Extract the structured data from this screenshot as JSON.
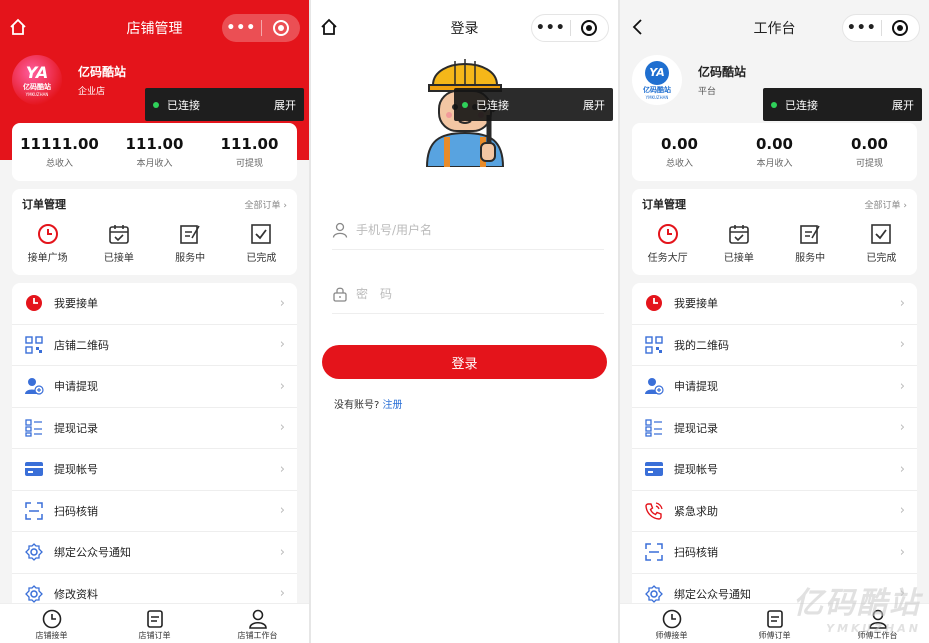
{
  "colors": {
    "accent": "#e4141b",
    "link": "#2a6fd6",
    "connected": "#2fd15a"
  },
  "common": {
    "capsule_dots": "•••",
    "connected": "已连接",
    "expand": "展开",
    "arrow": "›"
  },
  "panel1": {
    "title": "店铺管理",
    "store_name": "亿码酷站",
    "store_type": "企业店",
    "logo_text": "亿码酷站",
    "logo_sub": "YMKUZHAN",
    "stats": [
      {
        "value": "11111.00",
        "label": "总收入"
      },
      {
        "value": "111.00",
        "label": "本月收入"
      },
      {
        "value": "111.00",
        "label": "可提现"
      }
    ],
    "orders_title": "订单管理",
    "orders_all": "全部订单 ›",
    "order_items": [
      {
        "label": "接单广场",
        "icon": "clock-icon"
      },
      {
        "label": "已接单",
        "icon": "calendar-check-icon"
      },
      {
        "label": "服务中",
        "icon": "edit-icon"
      },
      {
        "label": "已完成",
        "icon": "checkbox-icon"
      }
    ],
    "menu": [
      {
        "label": "我要接单",
        "icon": "clock-filled-icon"
      },
      {
        "label": "店铺二维码",
        "icon": "qrcode-icon"
      },
      {
        "label": "申请提现",
        "icon": "user-add-icon"
      },
      {
        "label": "提现记录",
        "icon": "list-icon"
      },
      {
        "label": "提现帐号",
        "icon": "card-icon"
      },
      {
        "label": "扫码核销",
        "icon": "scan-icon"
      },
      {
        "label": "绑定公众号通知",
        "icon": "gear-icon"
      },
      {
        "label": "修改资料",
        "icon": "gear-icon"
      }
    ],
    "tabs": [
      {
        "label": "店铺接单",
        "icon": "clock-icon"
      },
      {
        "label": "店铺订单",
        "icon": "order-icon"
      },
      {
        "label": "店铺工作台",
        "icon": "person-icon"
      }
    ]
  },
  "panel2": {
    "title": "登录",
    "phone_placeholder": "手机号/用户名",
    "password_placeholder": "密　码",
    "login_button": "登录",
    "no_account": "没有账号?",
    "register": "注册"
  },
  "panel3": {
    "title": "工作台",
    "store_name": "亿码酷站",
    "store_type": "平台",
    "logo_text": "亿码酷站",
    "logo_sub": "YMKUZHAN",
    "stats": [
      {
        "value": "0.00",
        "label": "总收入"
      },
      {
        "value": "0.00",
        "label": "本月收入"
      },
      {
        "value": "0.00",
        "label": "可提现"
      }
    ],
    "orders_title": "订单管理",
    "orders_all": "全部订单 ›",
    "order_items": [
      {
        "label": "任务大厅",
        "icon": "clock-icon"
      },
      {
        "label": "已接单",
        "icon": "calendar-check-icon"
      },
      {
        "label": "服务中",
        "icon": "edit-icon"
      },
      {
        "label": "已完成",
        "icon": "checkbox-icon"
      }
    ],
    "menu": [
      {
        "label": "我要接单",
        "icon": "clock-filled-icon"
      },
      {
        "label": "我的二维码",
        "icon": "qrcode-icon"
      },
      {
        "label": "申请提现",
        "icon": "user-add-icon"
      },
      {
        "label": "提现记录",
        "icon": "list-icon"
      },
      {
        "label": "提现帐号",
        "icon": "card-icon"
      },
      {
        "label": "紧急求助",
        "icon": "phone-icon"
      },
      {
        "label": "扫码核销",
        "icon": "scan-icon"
      },
      {
        "label": "绑定公众号通知",
        "icon": "gear-icon"
      }
    ],
    "tabs": [
      {
        "label": "师傅接单",
        "icon": "clock-icon"
      },
      {
        "label": "师傅订单",
        "icon": "order-icon"
      },
      {
        "label": "师傅工作台",
        "icon": "person-icon"
      }
    ]
  },
  "watermark": {
    "main": "亿码酷站",
    "sub": "YMKUZHAN"
  }
}
